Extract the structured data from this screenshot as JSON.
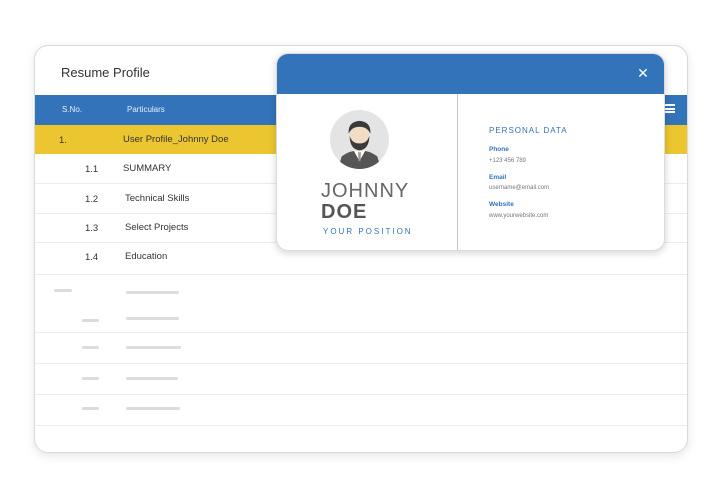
{
  "window": {
    "title": "Resume Profile"
  },
  "table": {
    "headers": {
      "sno": "S.No.",
      "particulars": "Particulars"
    },
    "rows": [
      {
        "num": "1.",
        "label": "User Profile_Johnny Doe"
      },
      {
        "num": "1.1",
        "label": "SUMMARY"
      },
      {
        "num": "1.2",
        "label": "Technical Skills"
      },
      {
        "num": "1.3",
        "label": "Select Projects"
      },
      {
        "num": "1.4",
        "label": "Education"
      }
    ]
  },
  "card": {
    "first_name": "JOHNNY",
    "last_name": "DOE",
    "position": "YOUR POSITION",
    "personal_data_title": "PERSONAL DATA",
    "fields": [
      {
        "label": "Phone",
        "value": "+123 456 789"
      },
      {
        "label": "Email",
        "value": "username@email.com"
      },
      {
        "label": "Website",
        "value": "www.yourwebsite.com"
      }
    ]
  },
  "colors": {
    "primary": "#3373b9",
    "highlight": "#ebc630"
  },
  "icons": [
    "menu-icon",
    "close-icon",
    "avatar-icon"
  ]
}
